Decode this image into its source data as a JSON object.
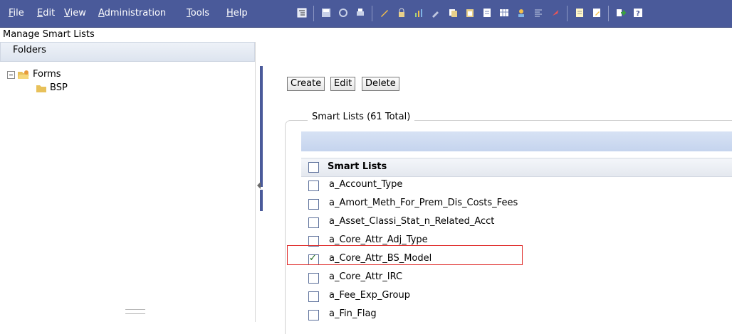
{
  "menubar": {
    "items": [
      {
        "label": "File",
        "key": "F"
      },
      {
        "label": "Edit",
        "key": "E"
      },
      {
        "label": "View",
        "key": "V"
      },
      {
        "label": "Administration",
        "key": "A"
      },
      {
        "label": "Tools",
        "key": "T"
      },
      {
        "label": "Help",
        "key": "H"
      }
    ],
    "toolbar_icons": [
      "toggle-tree-icon",
      "save-icon",
      "refresh-icon",
      "print-icon",
      "pencil-icon",
      "lock-icon",
      "chart-icon",
      "tools-icon",
      "copy-icon",
      "paste-icon",
      "document-icon",
      "grid-icon",
      "user-icon",
      "align-icon",
      "rocket-icon",
      "notes-icon",
      "edit-doc-icon",
      "exit-icon",
      "help-icon"
    ]
  },
  "page": {
    "title": "Manage Smart Lists"
  },
  "left_panel": {
    "header": "Folders",
    "tree": [
      {
        "label": "Forms",
        "expanded": true
      },
      {
        "label": "BSP"
      }
    ]
  },
  "main": {
    "buttons": {
      "create": "Create",
      "edit": "Edit",
      "delete": "Delete"
    },
    "group_title": "Smart Lists (61 Total)",
    "grid_header": "Smart Lists",
    "rows": [
      {
        "label": "a_Account_Type",
        "checked": false
      },
      {
        "label": "a_Amort_Meth_For_Prem_Dis_Costs_Fees",
        "checked": false
      },
      {
        "label": "a_Asset_Classi_Stat_n_Related_Acct",
        "checked": false
      },
      {
        "label": "a_Core_Attr_Adj_Type",
        "checked": false
      },
      {
        "label": "a_Core_Attr_BS_Model",
        "checked": true
      },
      {
        "label": "a_Core_Attr_IRC",
        "checked": false
      },
      {
        "label": "a_Fee_Exp_Group",
        "checked": false
      },
      {
        "label": "a_Fin_Flag",
        "checked": false
      }
    ]
  },
  "colors": {
    "menubar": "#4a5a9a",
    "highlight": "#e0302e",
    "header_strip": "#c5d4ee"
  }
}
